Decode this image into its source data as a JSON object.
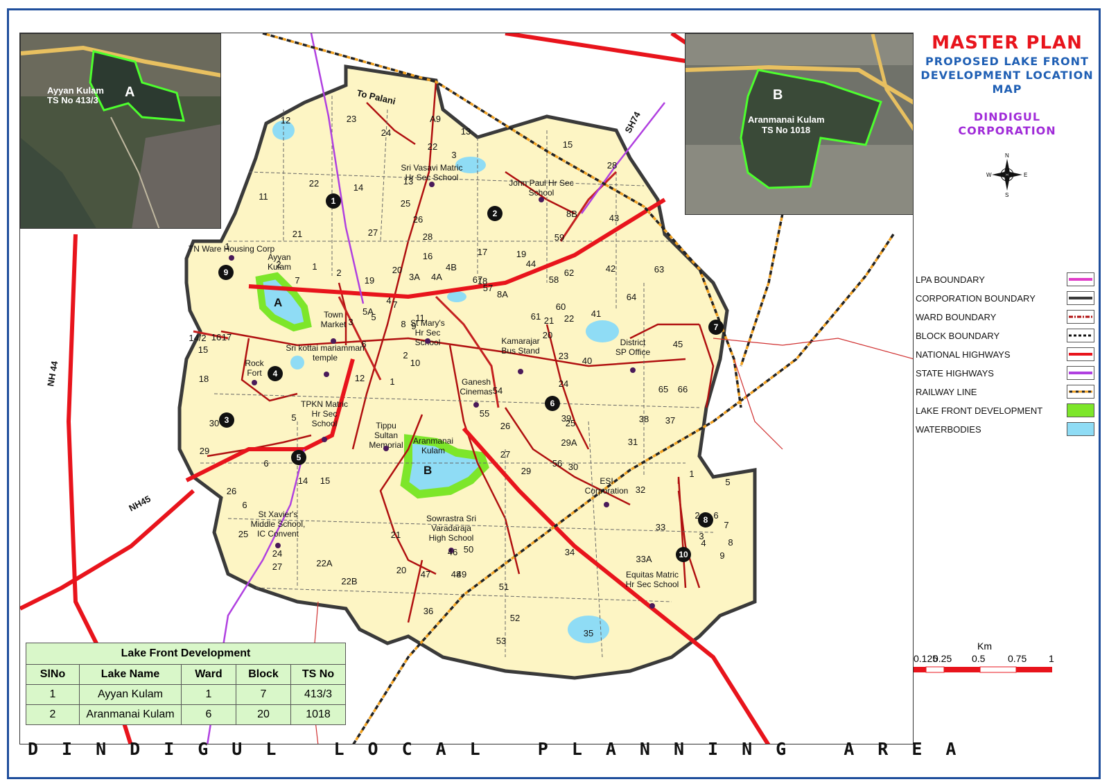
{
  "title": {
    "main": "MASTER PLAN",
    "sub_line1": "PROPOSED LAKE FRONT",
    "sub_line2": "DEVELOPMENT LOCATION",
    "sub_line3": "MAP",
    "corp_line1": "DINDIGUL",
    "corp_line2": "CORPORATION"
  },
  "bottom_title": "DINDIGUL LOCAL PLANNING AREA",
  "compass": {
    "n": "N",
    "s": "S",
    "e": "E",
    "w": "W"
  },
  "legend": [
    {
      "label": "LPA BOUNDARY",
      "color": "#e03cc8",
      "style": "solid"
    },
    {
      "label": "CORPORATION BOUNDARY",
      "color": "#3a3a3a",
      "style": "solid"
    },
    {
      "label": "WARD BOUNDARY",
      "color": "#b01010",
      "style": "dashdot"
    },
    {
      "label": "BLOCK BOUNDARY",
      "color": "#111111",
      "style": "dashed"
    },
    {
      "label": "NATIONAL HIGHWAYS",
      "color": "#e8141c",
      "style": "solid"
    },
    {
      "label": "STATE HIGHWAYS",
      "color": "#b040e0",
      "style": "solid"
    },
    {
      "label": "RAILWAY LINE",
      "color": "#f0a020",
      "style": "rail"
    },
    {
      "label": "LAKE FRONT DEVELOPMENT",
      "color": "#7de62a",
      "style": "fill"
    },
    {
      "label": "WATERBODIES",
      "color": "#8fdcf5",
      "style": "fill"
    }
  ],
  "scale": {
    "unit": "Km",
    "ticks": [
      "0",
      "0.125",
      "0.25",
      "0.5",
      "0.75",
      "1"
    ]
  },
  "inset_a": {
    "letter": "A",
    "name": "Ayyan Kulam",
    "ts": "TS No 413/3"
  },
  "inset_b": {
    "letter": "B",
    "name": "Aranmanai Kulam",
    "ts": "TS No 1018"
  },
  "roads": {
    "to_palani": "To Palani",
    "nh44": "NH 44",
    "nh45": "NH45",
    "sh74": "SH74"
  },
  "lakes": {
    "a": {
      "letter": "A",
      "label_line1": "Ayyan",
      "label_line2": "Kulam"
    },
    "b": {
      "letter": "B",
      "label_line1": "Aranmanai",
      "label_line2": "Kulam"
    }
  },
  "places": [
    [
      "TN Ware Housing Corp"
    ],
    [
      "Sri Vasavi Matric",
      "Hr Sec School"
    ],
    [
      "John Paul Hr Sec",
      "School"
    ],
    [
      "Town",
      "Market"
    ],
    [
      "St Mary's",
      "Hr Sec",
      "School"
    ],
    [
      "Sri kottai mariamman",
      "temple"
    ],
    [
      "Rock",
      "Fort"
    ],
    [
      "Kamarajar",
      "Bus Stand"
    ],
    [
      "District",
      "SP Office"
    ],
    [
      "Ganesh",
      "Cinemas"
    ],
    [
      "TPKN Matric",
      "Hr Sec",
      "School"
    ],
    [
      "Tippu",
      "Sultan",
      "Memorial"
    ],
    [
      "ESI",
      "Corporation"
    ],
    [
      "St Xavier's",
      "Middle School,",
      "IC Convent"
    ],
    [
      "Sowrastra Sri",
      "Varadaraja",
      "High School"
    ],
    [
      "Equitas Matric",
      "Hr Sec School"
    ]
  ],
  "blocks": [
    "1",
    "2",
    "3",
    "4",
    "5",
    "6",
    "7",
    "8",
    "9",
    "10"
  ],
  "wards": [
    "12",
    "23",
    "24",
    "13",
    "A9",
    "22",
    "15",
    "28",
    "11",
    "22",
    "14",
    "21",
    "7",
    "1",
    "2",
    "1",
    "2",
    "19",
    "20",
    "3A",
    "4A",
    "4B",
    "5A",
    "3",
    "4",
    "5",
    "6",
    "7",
    "8",
    "9",
    "10",
    "11",
    "12",
    "1",
    "2",
    "3",
    "13",
    "25",
    "26",
    "27",
    "28",
    "16",
    "17",
    "18",
    "19",
    "20",
    "21",
    "22",
    "23",
    "24",
    "25",
    "26",
    "27",
    "29",
    "29A",
    "30",
    "31",
    "32",
    "33",
    "33A",
    "34",
    "35",
    "36",
    "37",
    "38",
    "39",
    "40",
    "41",
    "42",
    "43",
    "44",
    "45",
    "46",
    "47",
    "48",
    "49",
    "50",
    "51",
    "52",
    "53",
    "54",
    "55",
    "56",
    "57",
    "58",
    "59",
    "60",
    "61",
    "62",
    "63",
    "64",
    "65",
    "66",
    "67",
    "8A",
    "8B",
    "14/2",
    "15",
    "16",
    "17",
    "18",
    "29",
    "30",
    "6",
    "5",
    "6",
    "26",
    "25",
    "24",
    "27",
    "22A",
    "22B",
    "21",
    "20",
    "14",
    "15",
    "1",
    "2",
    "3",
    "4",
    "5",
    "6",
    "7",
    "8",
    "9"
  ],
  "table": {
    "caption": "Lake Front Development",
    "headers": [
      "SlNo",
      "Lake  Name",
      "Ward",
      "Block",
      "TS No"
    ],
    "rows": [
      [
        "1",
        "Ayyan Kulam",
        "1",
        "7",
        "413/3"
      ],
      [
        "2",
        "Aranmanai Kulam",
        "6",
        "20",
        "1018"
      ]
    ]
  }
}
